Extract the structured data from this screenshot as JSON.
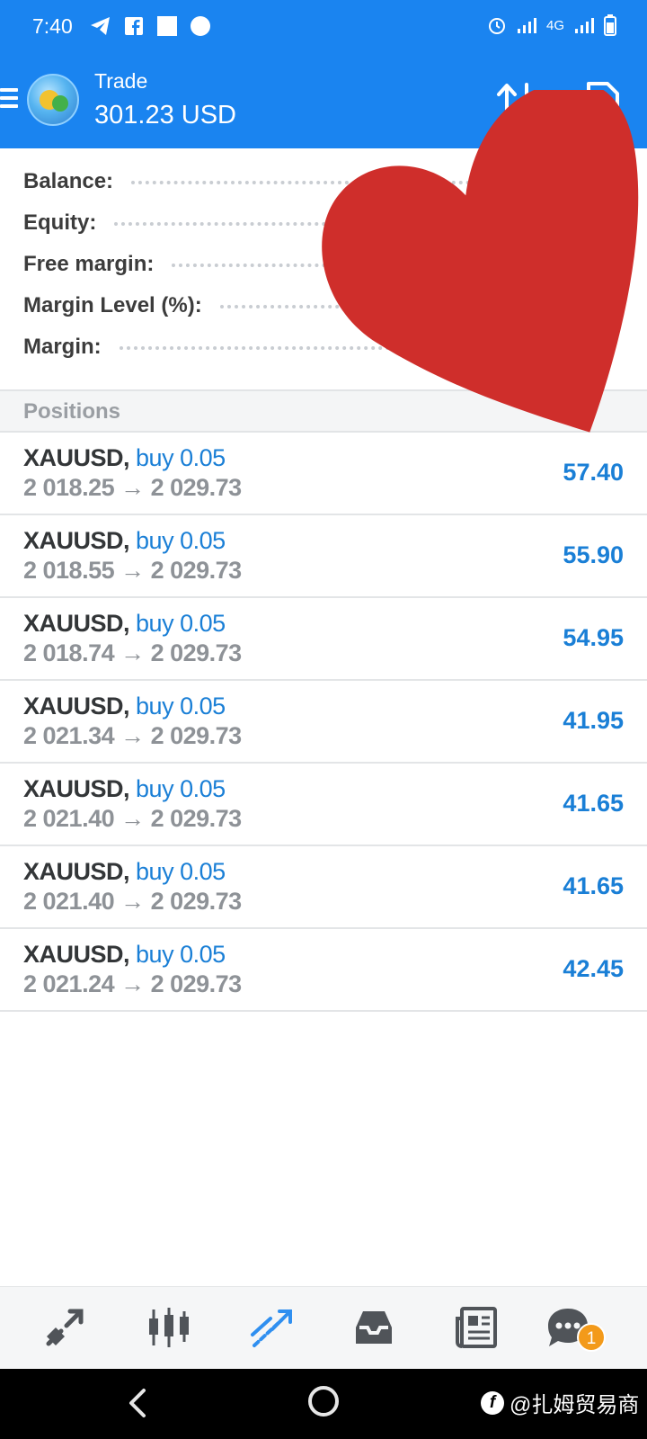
{
  "status_bar": {
    "time": "7:40",
    "network": "4G"
  },
  "header": {
    "title": "Trade",
    "balance": "301.23 USD"
  },
  "summary": [
    {
      "label": "Balance:",
      "value": ""
    },
    {
      "label": "Equity:",
      "value": ""
    },
    {
      "label": "Free margin:",
      "value": ""
    },
    {
      "label": "Margin Level (%):",
      "value": ""
    },
    {
      "label": "Margin:",
      "value": ""
    }
  ],
  "positions_header": "Positions",
  "positions": [
    {
      "symbol": "XAUUSD,",
      "direction": "buy 0.05",
      "prices": "2 018.25 → 2 029.73",
      "profit": "57.40"
    },
    {
      "symbol": "XAUUSD,",
      "direction": "buy 0.05",
      "prices": "2 018.55 → 2 029.73",
      "profit": "55.90"
    },
    {
      "symbol": "XAUUSD,",
      "direction": "buy 0.05",
      "prices": "2 018.74 → 2 029.73",
      "profit": "54.95"
    },
    {
      "symbol": "XAUUSD,",
      "direction": "buy 0.05",
      "prices": "2 021.34 → 2 029.73",
      "profit": "41.95"
    },
    {
      "symbol": "XAUUSD,",
      "direction": "buy 0.05",
      "prices": "2 021.40 → 2 029.73",
      "profit": "41.65"
    },
    {
      "symbol": "XAUUSD,",
      "direction": "buy 0.05",
      "prices": "2 021.40 → 2 029.73",
      "profit": "41.65"
    },
    {
      "symbol": "XAUUSD,",
      "direction": "buy 0.05",
      "prices": "2 021.24 → 2 029.73",
      "profit": "42.45"
    }
  ],
  "bottom_nav": [
    {
      "name": "quotes-icon",
      "active": false
    },
    {
      "name": "chart-candles-icon",
      "active": false
    },
    {
      "name": "trade-icon",
      "active": true
    },
    {
      "name": "history-inbox-icon",
      "active": false
    },
    {
      "name": "news-icon",
      "active": false
    },
    {
      "name": "chat-icon",
      "active": false
    }
  ],
  "chat_badge": "1",
  "watermark": "@扎姆贸易商",
  "colors": {
    "header_blue": "#1a84f0",
    "accent_blue": "#1a7fd6",
    "heart_red": "#cf2e2b",
    "badge_orange": "#f39a1a"
  }
}
